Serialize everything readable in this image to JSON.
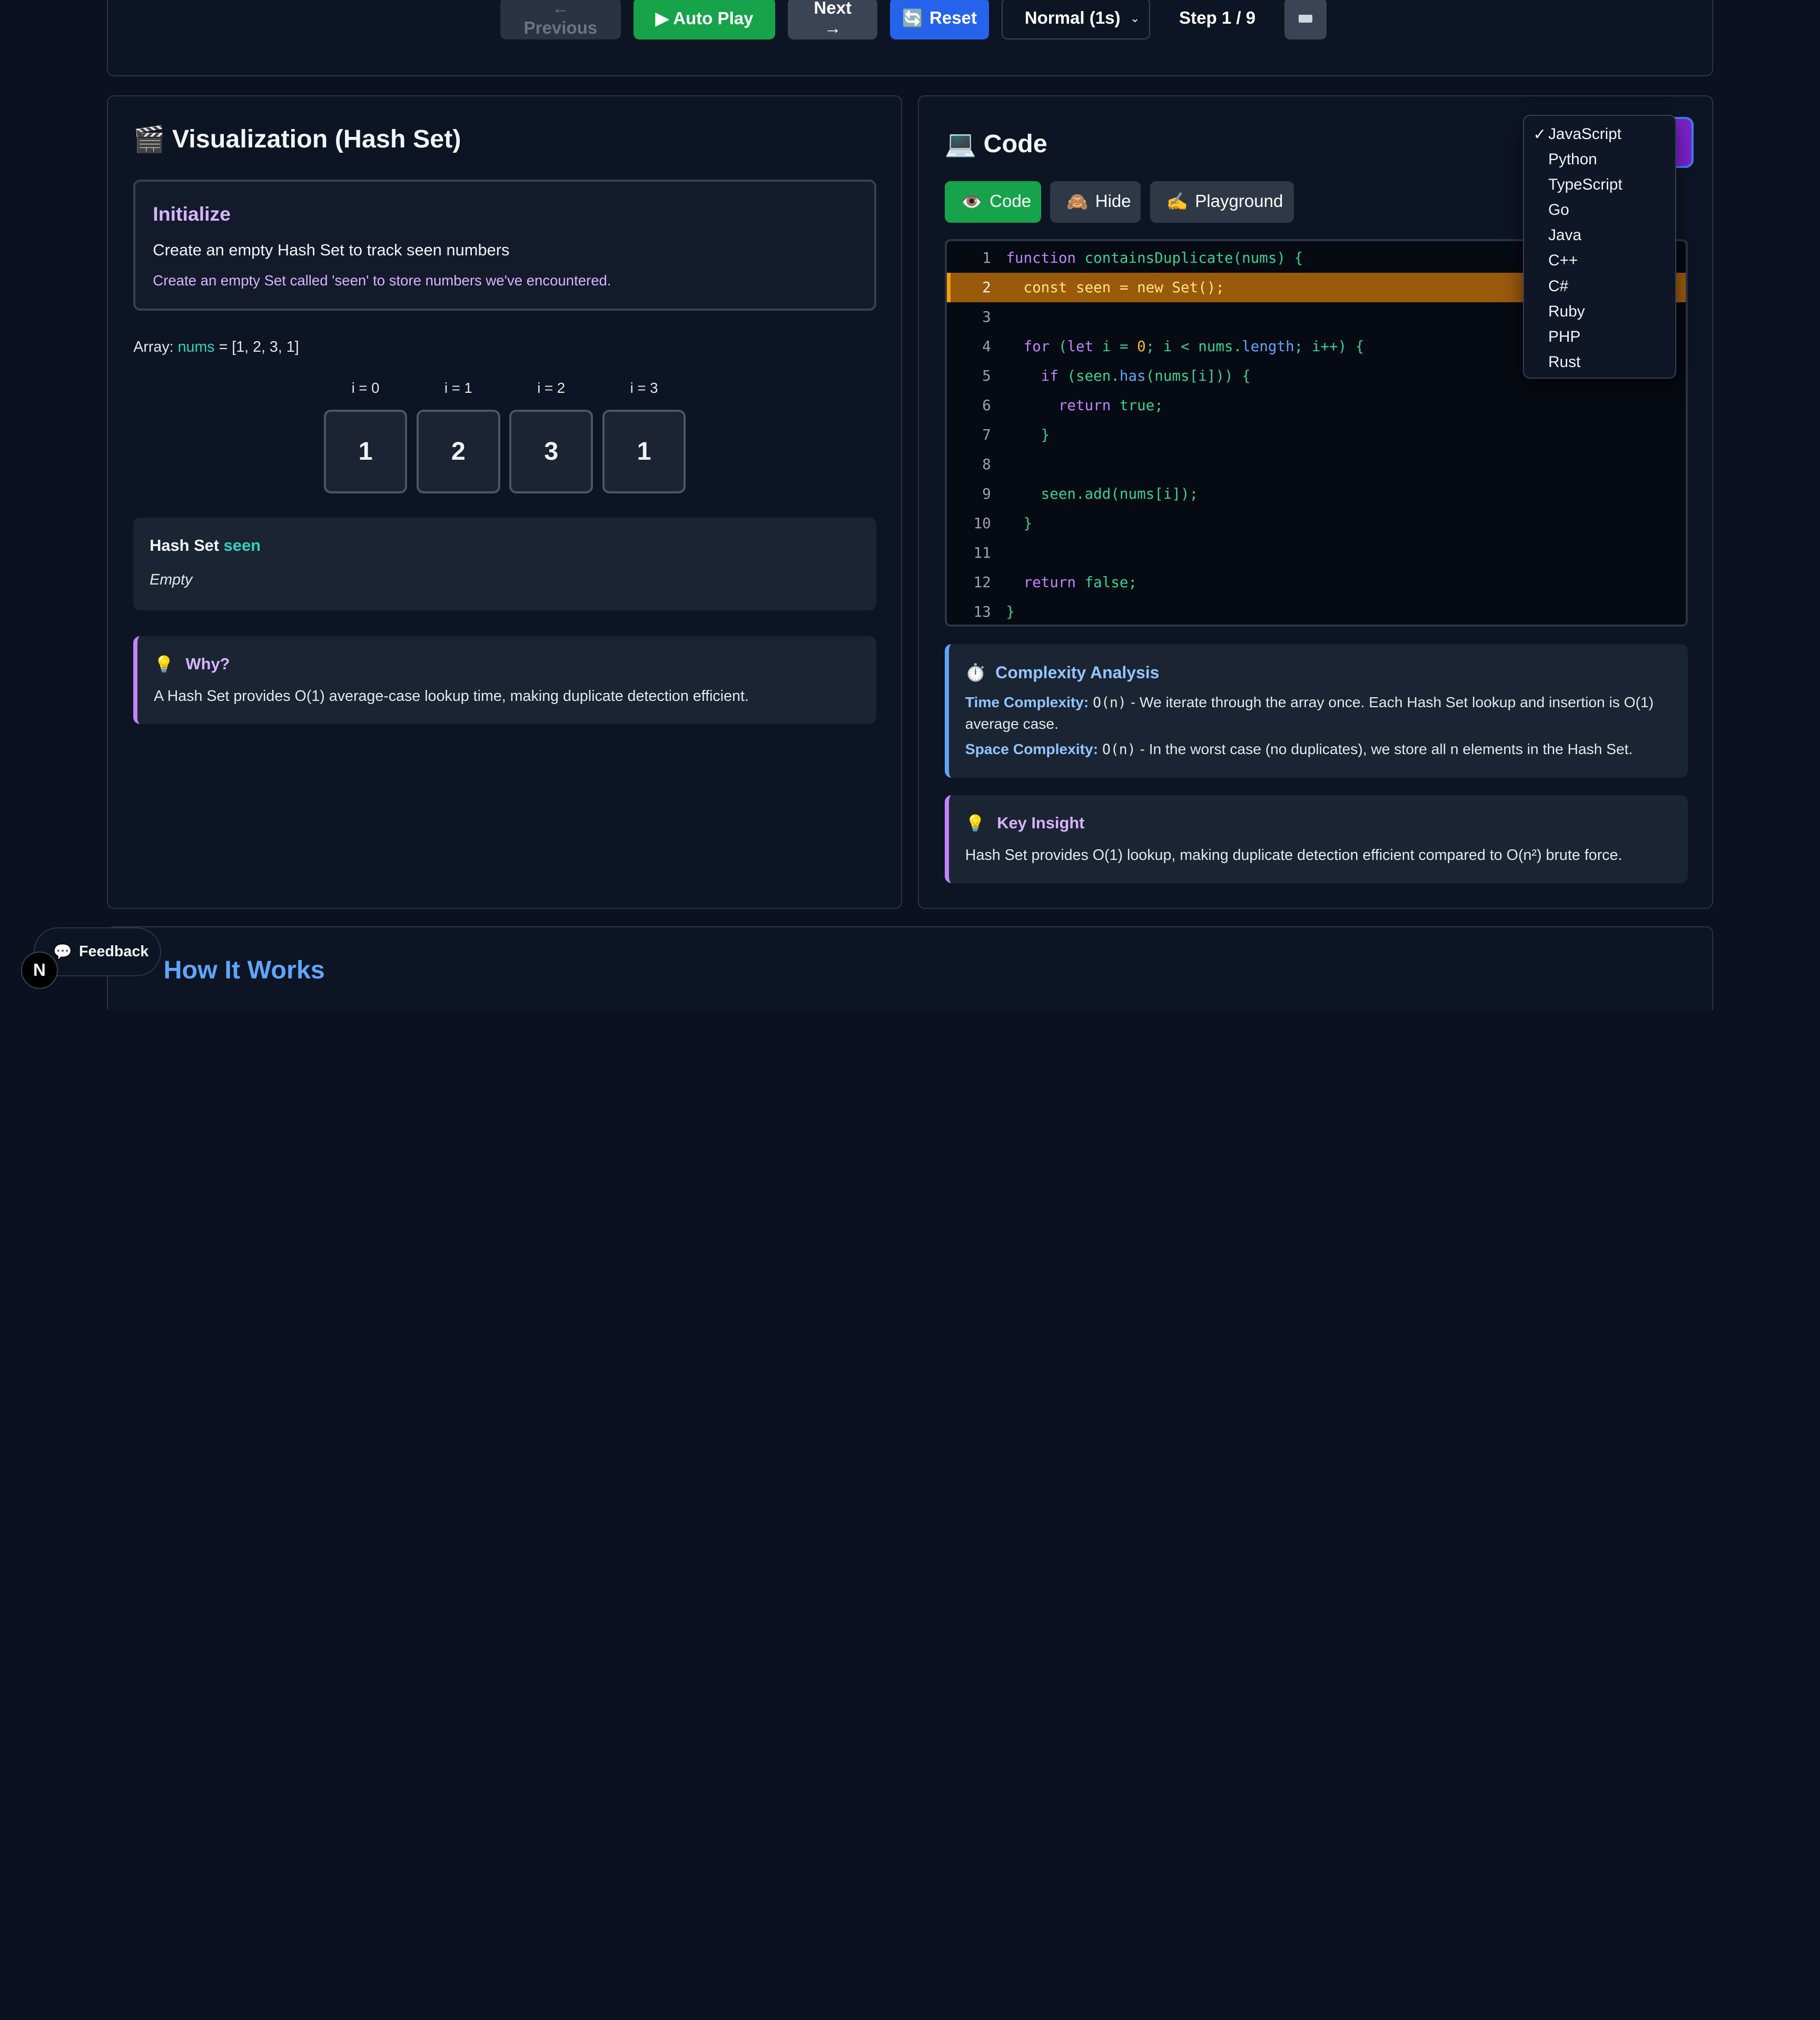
{
  "toolbar": {
    "previous_label": "← Previous",
    "autoplay_label": "▶ Auto Play",
    "next_label": "Next →",
    "reset_label": "Reset",
    "speed_value": "Normal (1s)",
    "step_label": "Step 1 / 9"
  },
  "visualization": {
    "title": "Visualization (Hash Set)",
    "step_title": "Initialize",
    "step_desc": "Create an empty Hash Set to track seen numbers",
    "step_detail": "Create an empty Set called 'seen' to store numbers we've encountered.",
    "array_prefix": "Array: ",
    "array_var": "nums",
    "array_value": " = [1, 2, 3, 1]",
    "cells": [
      {
        "index": "i = 0",
        "value": "1"
      },
      {
        "index": "i = 1",
        "value": "2"
      },
      {
        "index": "i = 2",
        "value": "3"
      },
      {
        "index": "i = 3",
        "value": "1"
      }
    ],
    "hashset_label": "Hash Set ",
    "hashset_var": "seen",
    "hashset_empty": "Empty",
    "why_title": "Why?",
    "why_text": "A Hash Set provides O(1) average-case lookup time, making duplicate detection efficient."
  },
  "code": {
    "title": "Code",
    "tabs": [
      "Code",
      "Hide",
      "Playground"
    ],
    "active_line": 2,
    "complexity_title": "Complexity Analysis",
    "time_label": "Time Complexity:",
    "time_value": "O(n)",
    "time_desc": " - We iterate through the array once. Each Hash Set lookup and insertion is O(1) average case.",
    "space_label": "Space Complexity:",
    "space_value": "O(n)",
    "space_desc": " - In the worst case (no duplicates), we store all n elements in the Hash Set.",
    "insight_title": "Key Insight",
    "insight_text": "Hash Set provides O(1) lookup, making duplicate detection efficient compared to O(n²) brute force."
  },
  "language_dropdown": {
    "selected": "JavaScript",
    "options": [
      "JavaScript",
      "Python",
      "TypeScript",
      "Go",
      "Java",
      "C++",
      "C#",
      "Ruby",
      "PHP",
      "Rust"
    ]
  },
  "how_it_works": {
    "title": "How It Works"
  },
  "feedback": {
    "label": "Feedback",
    "avatar_letter": "N"
  },
  "colors": {
    "accent_green": "#16a34a",
    "accent_blue": "#2563eb",
    "highlight": "#9a5a0c",
    "purple": "#c084fc"
  }
}
